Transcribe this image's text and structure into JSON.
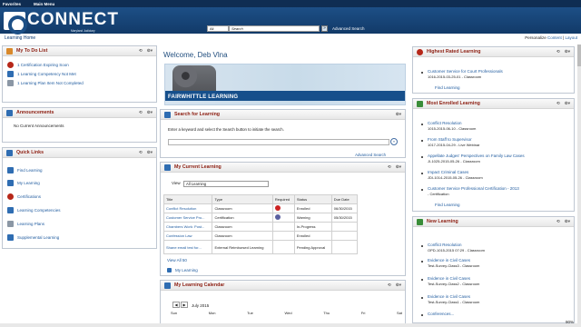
{
  "top_menu": [
    "Favorites",
    "Main Menu"
  ],
  "brand": {
    "name": "CONNECT",
    "sub": "Maryland Judiciary"
  },
  "global_search": {
    "scope": "All",
    "placeholder": "Search",
    "adv": "Advanced Search"
  },
  "page_title": "Learning Home",
  "personalize": {
    "label": "Personalize",
    "content": "Content",
    "separator": "|",
    "layout": "Layout"
  },
  "todo": {
    "title": "My To Do List",
    "items": [
      "1 Certification Expiring Soon",
      "1 Learning Competency Not Met",
      "1 Learning Plan Item Not Completed"
    ]
  },
  "announcements": {
    "title": "Announcements",
    "text": "No Current Announcements"
  },
  "quick_links": {
    "title": "Quick Links",
    "items": [
      "Find Learning",
      "My Learning",
      "Certifications",
      "Learning Competencies",
      "Learning Plans",
      "Supplemental Learning"
    ]
  },
  "welcome": {
    "text": "Welcome, Deb Vlna"
  },
  "fairwhittle": {
    "text": "FAIRWHITTLE LEARNING"
  },
  "search_learning": {
    "title": "Search for Learning",
    "prompt": "Enter a keyword and select the Search button to initiate the search.",
    "advanced": "Advanced Search"
  },
  "my_current": {
    "title": "My Current Learning",
    "view_label": "View",
    "view_value": "All Learning",
    "headers": [
      "Title",
      "Type",
      "Required",
      "Status",
      "Due Date"
    ],
    "rows": [
      [
        "Conflict Resolution",
        "Classroom",
        "",
        "Enrolled",
        "06/30/2015"
      ],
      [
        "Customer Service Pro...",
        "Certification",
        "",
        "Warning",
        "05/30/2015"
      ],
      [
        "Chambers Work: Post...",
        "Classroom",
        "",
        "In-Progress",
        ""
      ],
      [
        "Confession Law",
        "Classroom",
        "",
        "Enrolled",
        ""
      ],
      [
        "Shane email test for...",
        "External Reimbursed Learning",
        "",
        "Pending Approval",
        ""
      ]
    ],
    "view_all": "View All 50",
    "my_learning": "My Learning"
  },
  "calendar": {
    "title": "My Learning Calendar",
    "month": "July 2015",
    "days": [
      "Sun",
      "Mon",
      "Tue",
      "Wed",
      "Thu",
      "Fri",
      "Sat"
    ]
  },
  "highest_rated": {
    "title": "Highest Rated Learning",
    "items": [
      {
        "title": "Customer Service for Court Professionals",
        "meta": "1016-2015-03-25-01 - Classroom"
      }
    ],
    "find": "Find Learning"
  },
  "most_enrolled": {
    "title": "Most Enrolled Learning",
    "items": [
      {
        "title": "Conflict Resolution",
        "meta": "1015-2015-06-10 - Classroom"
      },
      {
        "title": "From Staff to Supervisor",
        "meta": "1017-2015-04-29 - Live Webinar"
      },
      {
        "title": "Appellate Judges' Perspectives on Family Law Cases",
        "meta": "JI-1025-2015-05-26 - Classroom"
      },
      {
        "title": "Impact Criminal Cases",
        "meta": "JDI-1014-2015-05-26 - Classroom"
      },
      {
        "title": "Customer Service Professional Certification - 2013",
        "meta": "- Certification"
      }
    ],
    "find": "Find Learning"
  },
  "new_learning": {
    "title": "New Learning",
    "items": [
      {
        "title": "Conflict Resolution",
        "meta": "OPD-1015-2015 07:29 - Classroom"
      },
      {
        "title": "Evidence in Civil Cases",
        "meta": "Test-Survey-Class3 - Classroom"
      },
      {
        "title": "Evidence in Civil Cases",
        "meta": "Test-Survey-Class2 - Classroom"
      },
      {
        "title": "Evidence in Civil Cases",
        "meta": "Test-Survey-Class1 - Classroom"
      },
      {
        "title": "Conferences...",
        "meta": ""
      }
    ]
  },
  "zoom": "90%"
}
